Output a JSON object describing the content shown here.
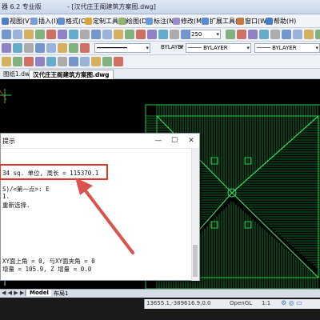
{
  "titlebar": {
    "app": "器 6.2 专业版",
    "doc": "- [汉代庄王阁建筑方案图.dwg]"
  },
  "menu": [
    {
      "key": "F",
      "label": "视图(V)",
      "color": "#4d7fc4"
    },
    {
      "key": "I",
      "label": "插入(I)",
      "color": "#7a9fd6"
    },
    {
      "key": "O",
      "label": "格式(O)",
      "color": "#5f8fcf"
    },
    {
      "key": "",
      "label": "定制工具(T)",
      "color": "#d7a43a"
    },
    {
      "key": "D",
      "label": "绘图(D)",
      "color": "#8fb56a"
    },
    {
      "key": "N",
      "label": "标注(N)",
      "color": "#6a9bd8"
    },
    {
      "key": "M",
      "label": "修改(M)",
      "color": "#9d8cc7"
    },
    {
      "key": "X",
      "label": "扩展工具(X)",
      "color": "#5c8ad1"
    },
    {
      "key": "W",
      "label": "窗口(W)",
      "color": "#c7783a"
    },
    {
      "key": "H",
      "label": "帮助(H)",
      "color": "#4b7ec9"
    }
  ],
  "toolbar": {
    "text_height": "250",
    "linetype": "BYLAYER",
    "lineweight": "BYLAYER",
    "plotstyle": "BYLAYER"
  },
  "tabs": [
    {
      "label": "图纸1.dwg",
      "active": false
    },
    {
      "label": "汉代庄王阁建筑方案图.dwg",
      "active": true
    }
  ],
  "dialog": {
    "title": "提示",
    "close": "✕",
    "min": "—",
    "max": "☐",
    "lines": [
      "34 sq. 单位, 周长 = 115370.1",
      "",
      "S)/<第一点>: E",
      "1.",
      "重新选择.",
      "",
      "",
      "",
      "",
      "",
      "",
      "XY面上角 = 0,  与XY面夹角 = 0",
      "增量 = 105.9,  Z 增量 = 0.0"
    ]
  },
  "layout_tabs": [
    "Model",
    "布局1"
  ],
  "status": {
    "coords": "13655.1,-389616.9,0.0",
    "opengl": "OpenGL",
    "scale": "1:1"
  },
  "colors": {
    "highlight_box": "#e0352b",
    "arrow": "#d9534f",
    "drawing_lines": "#25c94a"
  }
}
